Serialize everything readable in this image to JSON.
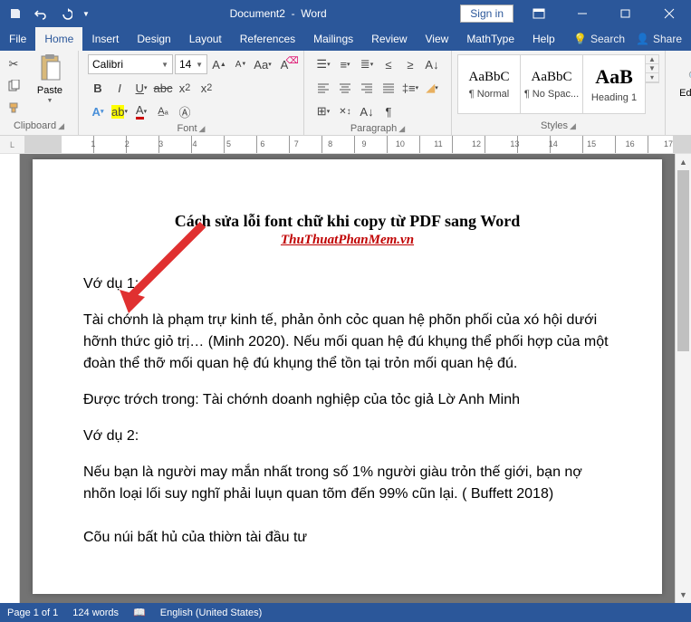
{
  "title": {
    "doc": "Document2",
    "app": "Word"
  },
  "signin": "Sign in",
  "tabs": {
    "file": "File",
    "home": "Home",
    "insert": "Insert",
    "design": "Design",
    "layout": "Layout",
    "references": "References",
    "mailings": "Mailings",
    "review": "Review",
    "view": "View",
    "mathtype": "MathType",
    "help": "Help"
  },
  "tellme": "Search",
  "share": "Share",
  "ribbon": {
    "clipboard": {
      "label": "Clipboard",
      "paste": "Paste"
    },
    "font": {
      "label": "Font",
      "name": "Calibri",
      "size": "14"
    },
    "paragraph": {
      "label": "Paragraph"
    },
    "styles": {
      "label": "Styles",
      "items": [
        {
          "preview": "AaBbC",
          "label": "¶ Normal",
          "size": "15px"
        },
        {
          "preview": "AaBbC",
          "label": "¶ No Spac...",
          "size": "15px"
        },
        {
          "preview": "AaB",
          "label": "Heading 1",
          "size": "22px"
        }
      ]
    },
    "editing": {
      "label": "Editing"
    }
  },
  "document": {
    "title": "Cách sửa lỗi font chữ khi copy từ PDF sang Word",
    "subtitle": "ThuThuatPhanMem.vn",
    "p1": "Vớ dụ 1:",
    "p2": "Tài chớnh là phạm trự kinh tế, phản ỏnh cỏc quan hệ phõn phối của xó hội dưới hỡnh thức giỏ trị… (Minh 2020). Nếu mối quan hệ đú khụng thể phối hợp của một đoàn thể thỡ mối quan hệ đú khụng thể tồn tại trỏn mối quan hệ đú.",
    "p3": "Được trớch trong: Tài chớnh doanh nghiệp của tỏc giả Lờ Anh Minh",
    "p4": "Vớ dụ 2:",
    "p5": "Nếu bạn là người may mắn nhất trong số 1% người giàu trỏn thế giới, bạn nợ nhõn loại lối suy nghĩ phải luụn quan tõm đến 99% cũn lại. ( Buffett 2018)",
    "p6": "Cõu núi bất hủ của thiờn tài đầu tư"
  },
  "status": {
    "page": "Page 1 of 1",
    "words": "124 words",
    "lang": "English (United States)"
  }
}
